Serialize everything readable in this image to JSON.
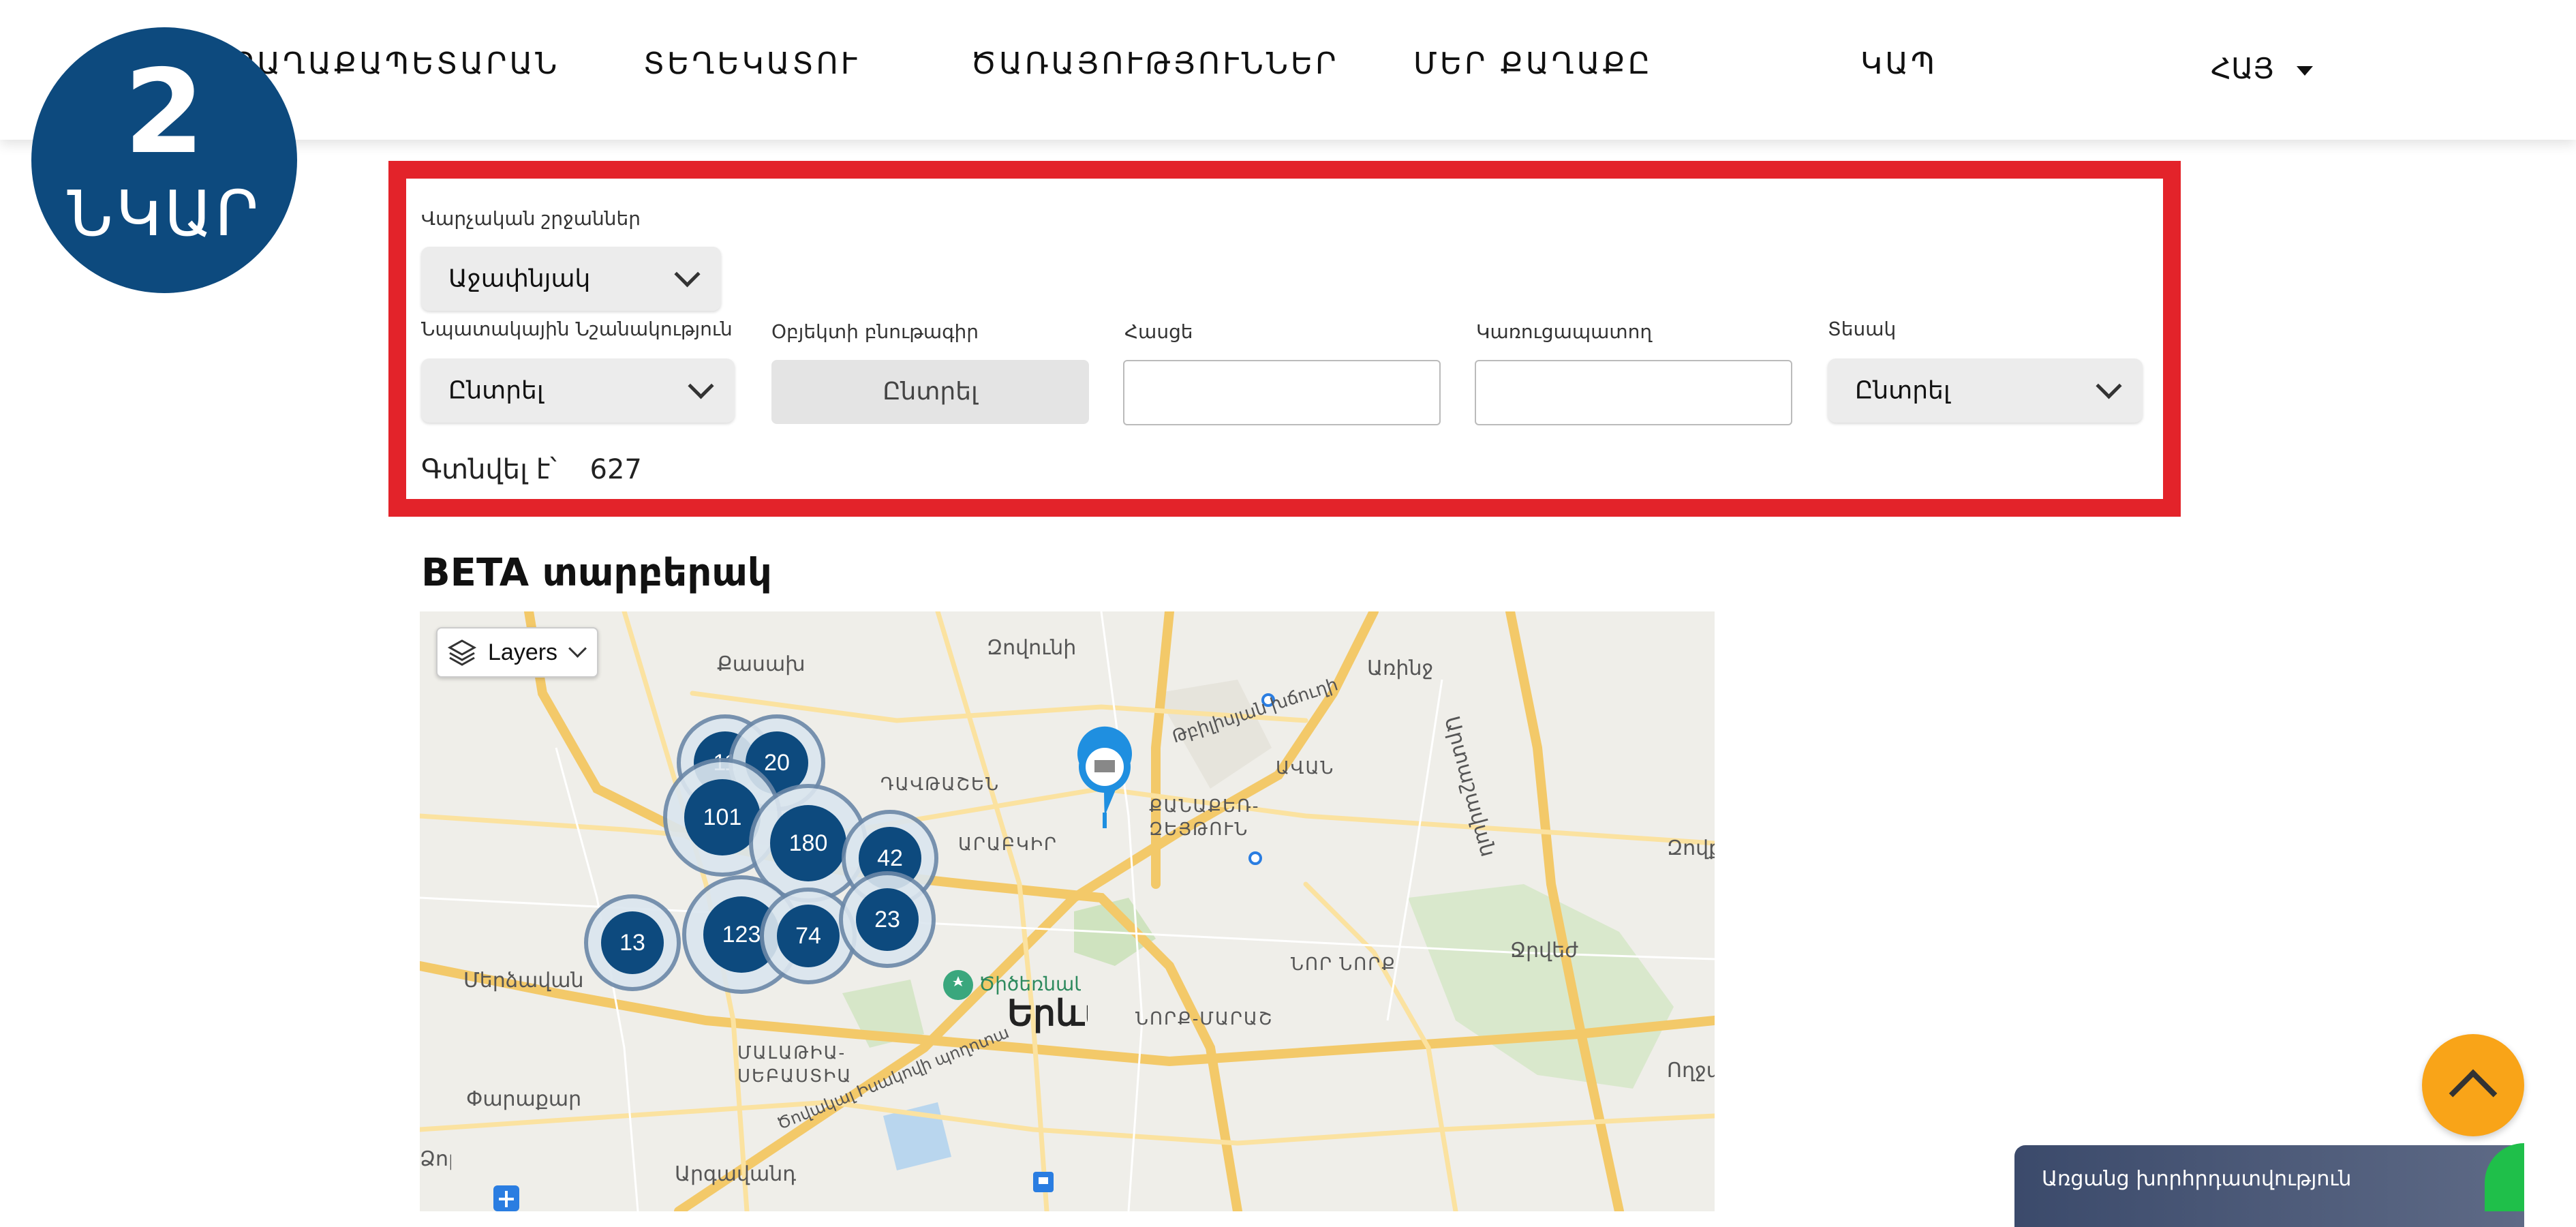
{
  "header": {
    "nav": [
      "ՔԱՂԱՔԱՊԵՏԱՐԱՆ",
      "ՏԵՂԵԿԱՏՈՒ",
      "ԾԱՌԱՅՈՒԹՅՈՒՆՆԵՐ",
      "ՄԵՐ ՔԱՂԱՔԸ",
      "ԿԱՊ"
    ],
    "language": "ՀԱՅ"
  },
  "badge": {
    "number": "2",
    "text": "ՆԿԱՐ"
  },
  "filters": {
    "districts_label": "Վարչական շրջաններ",
    "districts_value": "Աջափնյակ",
    "purpose_label": "Նպատակային Նշանակություն",
    "purpose_value": "Ընտրել",
    "object_label": "Օբյեկտի բնութագիր",
    "object_button": "Ընտրել",
    "address_label": "Հասցե",
    "address_value": "",
    "developer_label": "Կառուցապատող",
    "developer_value": "",
    "type_label": "Տեսակ",
    "type_value": "Ընտրել",
    "found_label": "Գտնվել է՝",
    "found_count": "627"
  },
  "beta_title": "BETA տարբերակ",
  "map": {
    "layers_label": "Layers",
    "place_labels": [
      "Քասախ",
      "Զովունի",
      "Առինջ",
      "Արտաշավան",
      "Թբիլիսյան խճուղի",
      "ԴԱՎԹԱՇԵՆ",
      "ԱՎԱՆ",
      "ՔԱՆԱՔԵՌ-ԶԵՅԹՈՒՆ",
      "ԱՐԱԲԿԻՐ",
      "Զովք",
      "Ջրվեժ",
      "ՆՈՐ ՆՈՐՔ",
      "Ծիծեռնակաբերդ",
      "Երևան",
      "ՆՈՐՔ-ՄԱՐԱՇ",
      "Մերձավան",
      "Փարաքար",
      "ՄԱԼԱԹԻԱ-ՍԵԲԱՍՏԻԱ",
      "Արգավանդ",
      "Ծովակալ Իսակովի պողոտա",
      "Ողջաբերդ",
      "Ձորաղբյուր"
    ],
    "city_label": "Երևան",
    "clusters": [
      "11",
      "20",
      "101",
      "180",
      "42",
      "13",
      "123",
      "74",
      "23"
    ]
  },
  "consult_label": "Առցանց խորհրդատվություն",
  "colors": {
    "primary": "#0d4a7e",
    "frame_red": "#e3232a",
    "scroll_orange": "#f9a418",
    "consult_bg": "#3b4a6b"
  }
}
